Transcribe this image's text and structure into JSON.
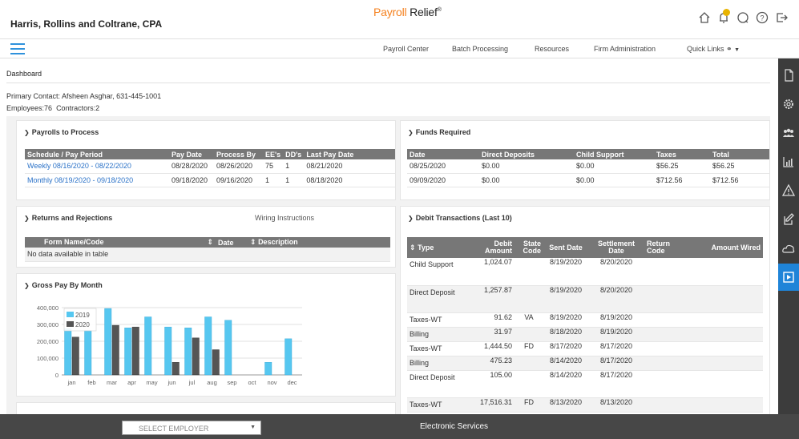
{
  "header": {
    "firm_name": "Harris, Rollins and Coltrane, CPA",
    "brand_part1": "Payroll",
    "brand_part2": " Relief",
    "brand_mark": "®",
    "icons": [
      "home-icon",
      "bell-icon",
      "chat-icon",
      "help-icon",
      "logout-icon"
    ]
  },
  "nav": {
    "items": [
      "Payroll Center",
      "Batch Processing",
      "Resources",
      "Firm Administration",
      "Quick Links"
    ]
  },
  "breadcrumb": "Dashboard",
  "info": {
    "primary_contact": "Primary Contact: Afsheen Asghar, 631-445-1001",
    "employees": "Employees:76",
    "contractors": "Contractors:2"
  },
  "payrolls": {
    "title": "Payrolls to Process",
    "headers": [
      "Schedule / Pay Period",
      "Pay Date",
      "Process By",
      "EE's",
      "DD's",
      "Last Pay Date"
    ],
    "rows": [
      [
        "Weekly 08/16/2020 - 08/22/2020",
        "08/28/2020",
        "08/26/2020",
        "75",
        "1",
        "08/21/2020"
      ],
      [
        "Monthly 08/19/2020 - 09/18/2020",
        "09/18/2020",
        "09/16/2020",
        "1",
        "1",
        "08/18/2020"
      ]
    ]
  },
  "funds": {
    "title": "Funds Required",
    "headers": [
      "Date",
      "Direct Deposits",
      "Child Support",
      "Taxes",
      "Total"
    ],
    "rows": [
      [
        "08/25/2020",
        "$0.00",
        "$0.00",
        "$56.25",
        "$56.25"
      ],
      [
        "09/09/2020",
        "$0.00",
        "$0.00",
        "$712.56",
        "$712.56"
      ]
    ]
  },
  "returns": {
    "title": "Returns and Rejections",
    "wiring_link": "Wiring Instructions",
    "headers": [
      "Form Name/Code",
      "Date",
      "Description"
    ],
    "empty": "No data available in table"
  },
  "debits": {
    "title": "Debit Transactions (Last 10)",
    "headers": [
      "Type",
      "Debit Amount",
      "State Code",
      "Sent Date",
      "Settlement Date",
      "Return Code",
      "Amount Wired"
    ],
    "rows": [
      [
        "Child Support",
        "1,024.07",
        "",
        "8/19/2020",
        "8/20/2020",
        "",
        ""
      ],
      [
        "Direct Deposit",
        "1,257.87",
        "",
        "8/19/2020",
        "8/20/2020",
        "",
        ""
      ],
      [
        "Taxes-WT",
        "91.62",
        "VA",
        "8/19/2020",
        "8/19/2020",
        "",
        ""
      ],
      [
        "Billing",
        "31.97",
        "",
        "8/18/2020",
        "8/19/2020",
        "",
        ""
      ],
      [
        "Taxes-WT",
        "1,444.50",
        "FD",
        "8/17/2020",
        "8/17/2020",
        "",
        ""
      ],
      [
        "Billing",
        "475.23",
        "",
        "8/14/2020",
        "8/17/2020",
        "",
        ""
      ],
      [
        "Direct Deposit",
        "105.00",
        "",
        "8/14/2020",
        "8/17/2020",
        "",
        ""
      ],
      [
        "Taxes-WT",
        "17,516.31",
        "FD",
        "8/13/2020",
        "8/13/2020",
        "",
        ""
      ]
    ]
  },
  "gross": {
    "title": "Gross Pay By Month"
  },
  "footer": {
    "select_placeholder": "SELECT EMPLOYER",
    "electronic_services": "Electronic Services"
  },
  "side_rail": [
    "document-icon",
    "gear-icon",
    "people-icon",
    "bar-chart-icon",
    "warning-icon",
    "edit-icon",
    "cloud-icon",
    "play-icon"
  ],
  "colors": {
    "accent": "#2f92dc",
    "brand_orange": "#f58220",
    "series_2019": "#56c7f0",
    "series_2020": "#555555"
  },
  "chart_data": {
    "type": "bar",
    "title": "Gross Pay By Month",
    "categories": [
      "jan",
      "feb",
      "mar",
      "apr",
      "may",
      "jun",
      "jul",
      "aug",
      "sep",
      "oct",
      "nov",
      "dec"
    ],
    "series": [
      {
        "name": "2019",
        "values": [
          275000,
          265000,
          395000,
          280000,
          345000,
          285000,
          280000,
          345000,
          325000,
          0,
          75000,
          215000
        ]
      },
      {
        "name": "2020",
        "values": [
          225000,
          0,
          295000,
          285000,
          0,
          75000,
          220000,
          150000,
          0,
          0,
          0,
          0
        ]
      }
    ],
    "ylim": [
      0,
      400000
    ],
    "yticks": [
      "0",
      "100,000",
      "200,000",
      "300,000",
      "400,000"
    ],
    "grid": true,
    "legend": "top-left"
  }
}
